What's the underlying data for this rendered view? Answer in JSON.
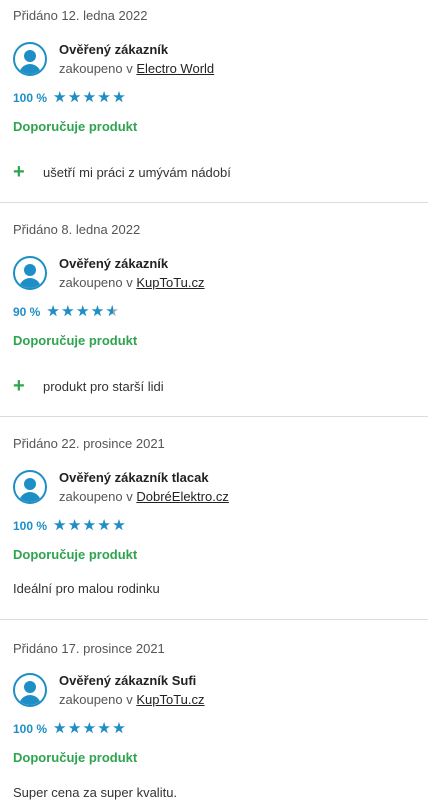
{
  "colors": {
    "accent": "#1e8fc6",
    "recommend": "#2ea44f",
    "divider": "#dcdcdc"
  },
  "reviews": [
    {
      "date": "Přidáno 12. ledna 2022",
      "author": "Ověřený zákazník",
      "purchase_prefix": "zakoupeno v",
      "shop": "Electro World",
      "rating_text": "100 %",
      "rating": 1.0,
      "recommend": "Doporučuje produkt",
      "plus_icon": "plus-icon",
      "pro": "ušetří mi práci z umývám nádobí"
    },
    {
      "date": "Přidáno 8. ledna 2022",
      "author": "Ověřený zákazník",
      "purchase_prefix": "zakoupeno v",
      "shop": "KupToTu.cz",
      "rating_text": "90 %",
      "rating": 0.9,
      "recommend": "Doporučuje produkt",
      "plus_icon": "plus-icon",
      "pro": "produkt pro starší lidi"
    },
    {
      "date": "Přidáno 22. prosince 2021",
      "author": "Ověřený zákazník tlacak",
      "purchase_prefix": "zakoupeno v",
      "shop": "DobréElektro.cz",
      "rating_text": "100 %",
      "rating": 1.0,
      "recommend": "Doporučuje produkt",
      "comment": "Ideální pro malou rodinku"
    },
    {
      "date": "Přidáno 17. prosince 2021",
      "author": "Ověřený zákazník Sufi",
      "purchase_prefix": "zakoupeno v",
      "shop": "KupToTu.cz",
      "rating_text": "100 %",
      "rating": 1.0,
      "recommend": "Doporučuje produkt",
      "comment": "Super cena za super kvalitu."
    }
  ]
}
